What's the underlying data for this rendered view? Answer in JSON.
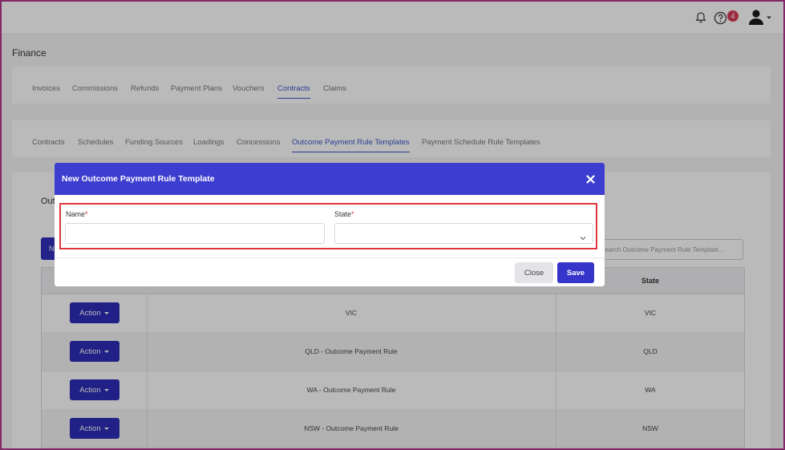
{
  "topbar": {
    "notification_count": "4",
    "icons": [
      "bell-icon",
      "help-icon",
      "user-avatar-icon",
      "chevron-down-icon"
    ]
  },
  "page": {
    "title": "Finance"
  },
  "finance_tabs": [
    {
      "label": "Invoices",
      "active": false
    },
    {
      "label": "Commissions",
      "active": false
    },
    {
      "label": "Refunds",
      "active": false
    },
    {
      "label": "Payment Plans",
      "active": false
    },
    {
      "label": "Vouchers",
      "active": false
    },
    {
      "label": "Contracts",
      "active": true
    },
    {
      "label": "Claims",
      "active": false
    }
  ],
  "contract_tabs": [
    {
      "label": "Contracts",
      "active": false
    },
    {
      "label": "Schedules",
      "active": false
    },
    {
      "label": "Funding Sources",
      "active": false
    },
    {
      "label": "Loadings",
      "active": false
    },
    {
      "label": "Concessions",
      "active": false
    },
    {
      "label": "Outcome Payment Rule Templates",
      "active": true
    },
    {
      "label": "Payment Schedule Rule Templates",
      "active": false
    }
  ],
  "background": {
    "section_title": "Out",
    "new_button_label": "N",
    "search_placeholder": "Search Outcome Payment Rule Template...",
    "table": {
      "state_header": "State",
      "rows": [
        {
          "action": "Action",
          "name": "VIC",
          "state": "VIC"
        },
        {
          "action": "Action",
          "name": "QLD - Outcome Payment Rule",
          "state": "QLD"
        },
        {
          "action": "Action",
          "name": "WA - Outcome Payment Rule",
          "state": "WA"
        },
        {
          "action": "Action",
          "name": "NSW - Outcome Payment Rule",
          "state": "NSW"
        }
      ]
    }
  },
  "modal": {
    "title": "New Outcome Payment Rule Template",
    "name_label": "Name",
    "state_label": "State",
    "required_mark": "*",
    "name_value": "",
    "state_value": "",
    "close_label": "Close",
    "save_label": "Save"
  },
  "colors": {
    "primary": "#3d3dd0",
    "action_button": "#2d2db8",
    "highlight": "#e0353a",
    "badge": "#d63b5a",
    "active_tab": "#3a55c8",
    "frame_border": "#b3368f"
  }
}
